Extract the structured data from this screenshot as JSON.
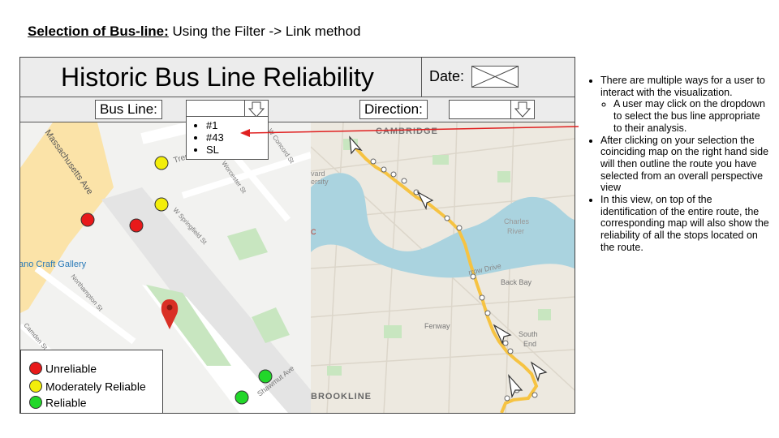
{
  "slide": {
    "title_bold": "Selection of Bus-line:",
    "title_rest": " Using the Filter -> Link method"
  },
  "app": {
    "title": "Historic Bus Line Reliability",
    "date_label": "Date:",
    "bus_line_label": "Bus Line:",
    "direction_label": "Direction:",
    "bus_line_options": [
      "#1",
      "#43",
      "SL"
    ]
  },
  "map_left": {
    "streets": [
      "Massachusetts Ave",
      "Tremont",
      "W Concord St",
      "Worcester St",
      "W Springfield St",
      "Northampton St",
      "Camden St",
      "Shawmut Ave"
    ],
    "places": [
      "ano Craft Gallery"
    ]
  },
  "map_right": {
    "places": [
      "CAMBRIDGE",
      "vard",
      "ersity",
      "Charles",
      "River",
      "Back Bay",
      "rrow Drive",
      "Fenway",
      "South",
      "End",
      "BROOKLINE",
      "C"
    ]
  },
  "legend": {
    "items": [
      {
        "label": "Unreliable",
        "color": "#e8191a"
      },
      {
        "label": "Moderately Reliable",
        "color": "#f3ee0a"
      },
      {
        "label": "Reliable",
        "color": "#22d72a"
      }
    ]
  },
  "notes": {
    "bullet1": "There are multiple ways for a user to interact with the visualization.",
    "sub1": "A user may click on the dropdown to select the bus line appropriate to their analysis.",
    "bullet2": "After clicking on your selection the coinciding map on the right hand side will then outline the route you have selected from an overall perspective view",
    "bullet3": "In this view, on top of the identification of the entire route, the corresponding map will also show the reliability of all the stops located on the route."
  },
  "colors": {
    "route": "#f6c342",
    "arrow": "#e02020",
    "water": "#aad3df",
    "park": "#c8e6c0",
    "mass_ave": "#fbe3a8"
  }
}
